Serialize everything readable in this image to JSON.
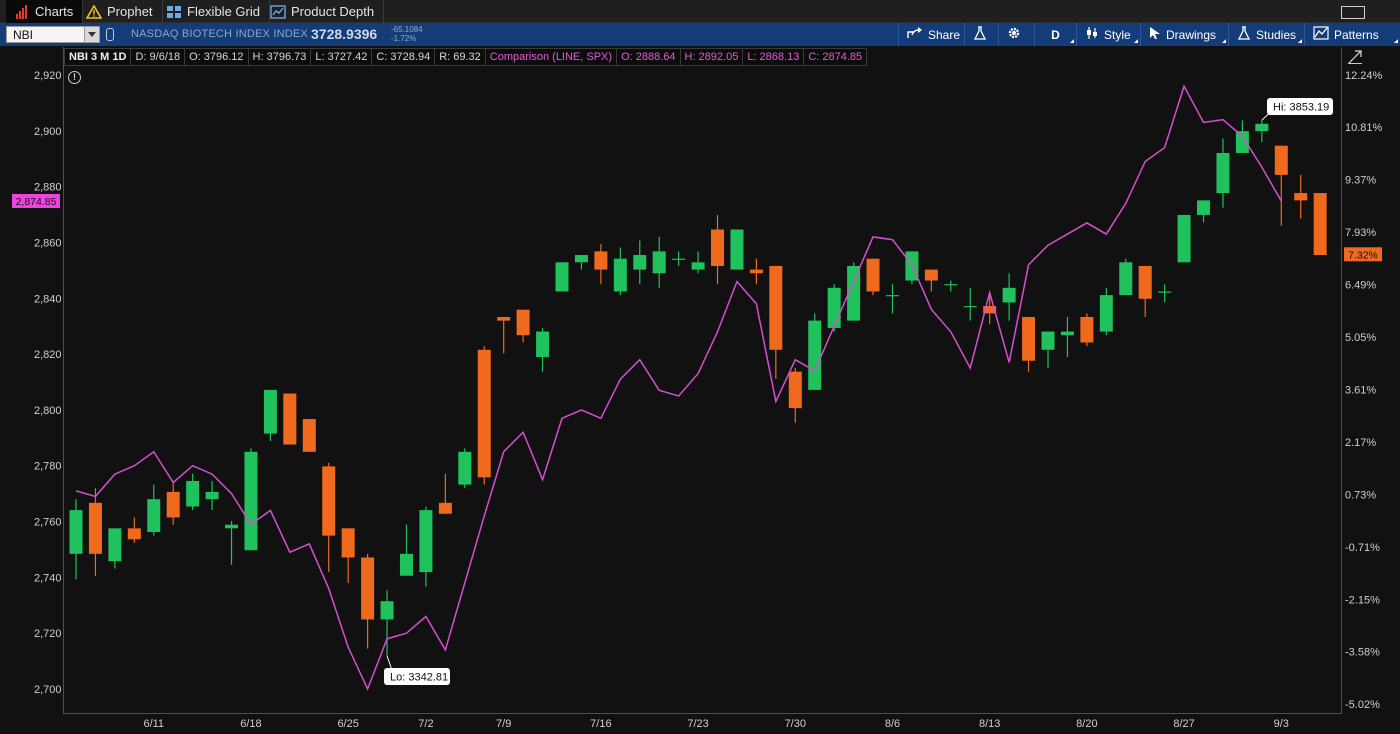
{
  "tabs": [
    {
      "label": "Charts",
      "icon": "bar-chart-icon"
    },
    {
      "label": "Prophet",
      "icon": "warning-triangle-icon"
    },
    {
      "label": "Flexible Grid",
      "icon": "grid-icon"
    },
    {
      "label": "Product Depth",
      "icon": "depth-icon"
    }
  ],
  "toolbar": {
    "symbol": "NBI",
    "index_name": "NASDAQ BIOTECH INDEX INDEX",
    "last_price": "3728.9396",
    "net_change": "-65.1084",
    "pct_change": "-1.72%",
    "share_label": "Share",
    "period_label": "D",
    "style_label": "Style",
    "drawings_label": "Drawings",
    "studies_label": "Studies",
    "patterns_label": "Patterns"
  },
  "header": {
    "title": "NBI 3 M 1D",
    "date": "D: 9/6/18",
    "open": "O: 3796.12",
    "high": "H: 3796.73",
    "low": "L: 3727.42",
    "close": "C: 3728.94",
    "range": "R: 69.32",
    "comparison": "Comparison (LINE, SPX)",
    "cmp_open": "O: 2888.64",
    "cmp_high": "H: 2892.05",
    "cmp_low": "L: 2868.13",
    "cmp_close": "C: 2874.85"
  },
  "colors": {
    "up": "#1fc25c",
    "down": "#f06a1e",
    "comparison": "#d64fcf",
    "tag_bg": "#ef43e0"
  },
  "chart_data": {
    "type": "candlestick",
    "left_axis": {
      "ticks": [
        "2,920",
        "2,900",
        "2,880",
        "2,860",
        "2,840",
        "2,820",
        "2,800",
        "2,780",
        "2,760",
        "2,740",
        "2,720",
        "2,700"
      ],
      "values": [
        2920,
        2900,
        2880,
        2860,
        2840,
        2820,
        2800,
        2780,
        2760,
        2740,
        2720,
        2700
      ]
    },
    "right_axis": {
      "ticks": [
        "12.24%",
        "10.81%",
        "9.37%",
        "7.93%",
        "6.49%",
        "5.05%",
        "3.61%",
        "2.17%",
        "0.73%",
        "-0.71%",
        "-2.15%",
        "-3.58%",
        "-5.02%"
      ],
      "values": [
        12.24,
        10.81,
        9.37,
        7.93,
        6.49,
        5.05,
        3.61,
        2.17,
        0.73,
        -0.71,
        -2.15,
        -3.58,
        -5.02
      ]
    },
    "x_labels": [
      "6/11",
      "6/18",
      "6/25",
      "7/2",
      "7/9",
      "7/16",
      "7/23",
      "7/30",
      "8/6",
      "8/13",
      "8/20",
      "8/27",
      "9/3"
    ],
    "label_bar_index": [
      4,
      9,
      14,
      18,
      22,
      27,
      32,
      37,
      42,
      47,
      52,
      57,
      62
    ],
    "ylim_right": [
      -5.02,
      12.24
    ],
    "candles": [
      {
        "o": -0.9,
        "h": 0.6,
        "l": -1.6,
        "c": 0.3
      },
      {
        "o": 0.5,
        "h": 0.9,
        "l": -1.5,
        "c": -0.9
      },
      {
        "o": -1.1,
        "h": -0.3,
        "l": -1.3,
        "c": -0.2
      },
      {
        "o": -0.2,
        "h": 0.1,
        "l": -0.6,
        "c": -0.5
      },
      {
        "o": -0.3,
        "h": 1.0,
        "l": -0.4,
        "c": 0.6
      },
      {
        "o": 0.8,
        "h": 1.1,
        "l": -0.1,
        "c": 0.1
      },
      {
        "o": 0.4,
        "h": 1.3,
        "l": 0.3,
        "c": 1.1
      },
      {
        "o": 0.6,
        "h": 1.1,
        "l": 0.3,
        "c": 0.8
      },
      {
        "o": -0.2,
        "h": 0.0,
        "l": -1.2,
        "c": -0.1
      },
      {
        "o": -0.8,
        "h": 2.0,
        "l": -0.8,
        "c": 1.9
      },
      {
        "o": 2.4,
        "h": 3.6,
        "l": 2.2,
        "c": 3.6
      },
      {
        "o": 3.5,
        "h": 3.5,
        "l": 2.1,
        "c": 2.1
      },
      {
        "o": 2.8,
        "h": 2.8,
        "l": 2.0,
        "c": 1.9
      },
      {
        "o": 1.5,
        "h": 1.6,
        "l": -1.4,
        "c": -0.4
      },
      {
        "o": -0.2,
        "h": -0.2,
        "l": -1.7,
        "c": -1.0
      },
      {
        "o": -1.0,
        "h": -0.9,
        "l": -3.5,
        "c": -2.7
      },
      {
        "o": -2.7,
        "h": -1.9,
        "l": -3.7,
        "c": -2.2
      },
      {
        "o": -1.5,
        "h": -0.1,
        "l": -1.5,
        "c": -0.9
      },
      {
        "o": -1.4,
        "h": 0.4,
        "l": -1.8,
        "c": 0.3
      },
      {
        "o": 0.5,
        "h": 1.3,
        "l": 0.2,
        "c": 0.2
      },
      {
        "o": 1.0,
        "h": 2.0,
        "l": 0.9,
        "c": 1.9
      },
      {
        "o": 4.7,
        "h": 4.8,
        "l": 1.0,
        "c": 1.2
      },
      {
        "o": 5.6,
        "h": 5.6,
        "l": 4.6,
        "c": 5.5
      },
      {
        "o": 5.8,
        "h": 5.8,
        "l": 4.9,
        "c": 5.1
      },
      {
        "o": 4.5,
        "h": 5.3,
        "l": 4.1,
        "c": 5.2
      },
      {
        "o": 6.3,
        "h": 7.1,
        "l": 6.3,
        "c": 7.1
      },
      {
        "o": 7.1,
        "h": 7.3,
        "l": 6.9,
        "c": 7.3
      },
      {
        "o": 7.4,
        "h": 7.6,
        "l": 6.5,
        "c": 6.9
      },
      {
        "o": 6.3,
        "h": 7.5,
        "l": 6.2,
        "c": 7.2
      },
      {
        "o": 6.9,
        "h": 7.7,
        "l": 6.5,
        "c": 7.3
      },
      {
        "o": 6.8,
        "h": 7.8,
        "l": 6.4,
        "c": 7.4
      },
      {
        "o": 7.2,
        "h": 7.4,
        "l": 7.0,
        "c": 7.2
      },
      {
        "o": 6.9,
        "h": 7.4,
        "l": 6.8,
        "c": 7.1
      },
      {
        "o": 8.0,
        "h": 8.4,
        "l": 6.5,
        "c": 7.0
      },
      {
        "o": 6.9,
        "h": 8.0,
        "l": 6.9,
        "c": 8.0
      },
      {
        "o": 6.9,
        "h": 7.2,
        "l": 6.5,
        "c": 6.8
      },
      {
        "o": 7.0,
        "h": 7.0,
        "l": 3.9,
        "c": 4.7
      },
      {
        "o": 4.1,
        "h": 4.2,
        "l": 2.7,
        "c": 3.1
      },
      {
        "o": 3.6,
        "h": 5.7,
        "l": 3.6,
        "c": 5.5
      },
      {
        "o": 5.3,
        "h": 6.5,
        "l": 5.2,
        "c": 6.4
      },
      {
        "o": 5.5,
        "h": 7.1,
        "l": 5.5,
        "c": 7.0
      },
      {
        "o": 7.2,
        "h": 7.2,
        "l": 6.2,
        "c": 6.3
      },
      {
        "o": 6.2,
        "h": 6.5,
        "l": 5.7,
        "c": 6.2
      },
      {
        "o": 6.6,
        "h": 7.4,
        "l": 6.5,
        "c": 7.4
      },
      {
        "o": 6.9,
        "h": 6.9,
        "l": 6.3,
        "c": 6.6
      },
      {
        "o": 6.5,
        "h": 6.6,
        "l": 6.3,
        "c": 6.5
      },
      {
        "o": 5.9,
        "h": 6.4,
        "l": 5.5,
        "c": 5.9
      },
      {
        "o": 5.9,
        "h": 6.2,
        "l": 5.4,
        "c": 5.7
      },
      {
        "o": 6.0,
        "h": 6.8,
        "l": 5.5,
        "c": 6.4
      },
      {
        "o": 5.6,
        "h": 5.6,
        "l": 4.1,
        "c": 4.4
      },
      {
        "o": 4.7,
        "h": 5.2,
        "l": 4.2,
        "c": 5.2
      },
      {
        "o": 5.1,
        "h": 5.6,
        "l": 4.5,
        "c": 5.2
      },
      {
        "o": 5.6,
        "h": 5.7,
        "l": 4.8,
        "c": 4.9
      },
      {
        "o": 5.2,
        "h": 6.4,
        "l": 5.1,
        "c": 6.2
      },
      {
        "o": 6.2,
        "h": 7.2,
        "l": 6.2,
        "c": 7.1
      },
      {
        "o": 7.0,
        "h": 7.0,
        "l": 5.6,
        "c": 6.1
      },
      {
        "o": 6.3,
        "h": 6.5,
        "l": 6.0,
        "c": 6.3
      },
      {
        "o": 7.1,
        "h": 8.4,
        "l": 7.1,
        "c": 8.4
      },
      {
        "o": 8.4,
        "h": 8.8,
        "l": 8.2,
        "c": 8.8
      },
      {
        "o": 9.0,
        "h": 10.5,
        "l": 8.6,
        "c": 10.1
      },
      {
        "o": 10.1,
        "h": 11.0,
        "l": 10.1,
        "c": 10.7
      },
      {
        "o": 10.7,
        "h": 11.0,
        "l": 10.4,
        "c": 10.9
      },
      {
        "o": 10.3,
        "h": 10.3,
        "l": 8.1,
        "c": 9.5
      },
      {
        "o": 9.0,
        "h": 9.5,
        "l": 8.3,
        "c": 8.8
      },
      {
        "o": 9.0,
        "h": 9.0,
        "l": 7.3,
        "c": 7.3
      }
    ],
    "comparison_series": {
      "name": "SPX",
      "values": [
        2771,
        2769,
        2777,
        2780,
        2785,
        2774,
        2780,
        2777,
        2770,
        2759,
        2764,
        2749,
        2752,
        2736,
        2715,
        2700,
        2718,
        2720,
        2726,
        2714,
        2738,
        2762,
        2785,
        2792,
        2775,
        2797,
        2800,
        2797,
        2811,
        2818,
        2807,
        2805,
        2813,
        2828,
        2846,
        2838,
        2803,
        2818,
        2814,
        2830,
        2846,
        2862,
        2861,
        2852,
        2836,
        2828,
        2815,
        2842,
        2817,
        2852,
        2859,
        2863,
        2867,
        2863,
        2874,
        2889,
        2894,
        2916,
        2903,
        2904,
        2898,
        2887,
        2874.85
      ]
    },
    "hi_label": "Hi: 3853.19",
    "lo_label": "Lo: 3342.81",
    "last_tag_left": "2,874.85",
    "last_tag_right": "7.32%"
  }
}
